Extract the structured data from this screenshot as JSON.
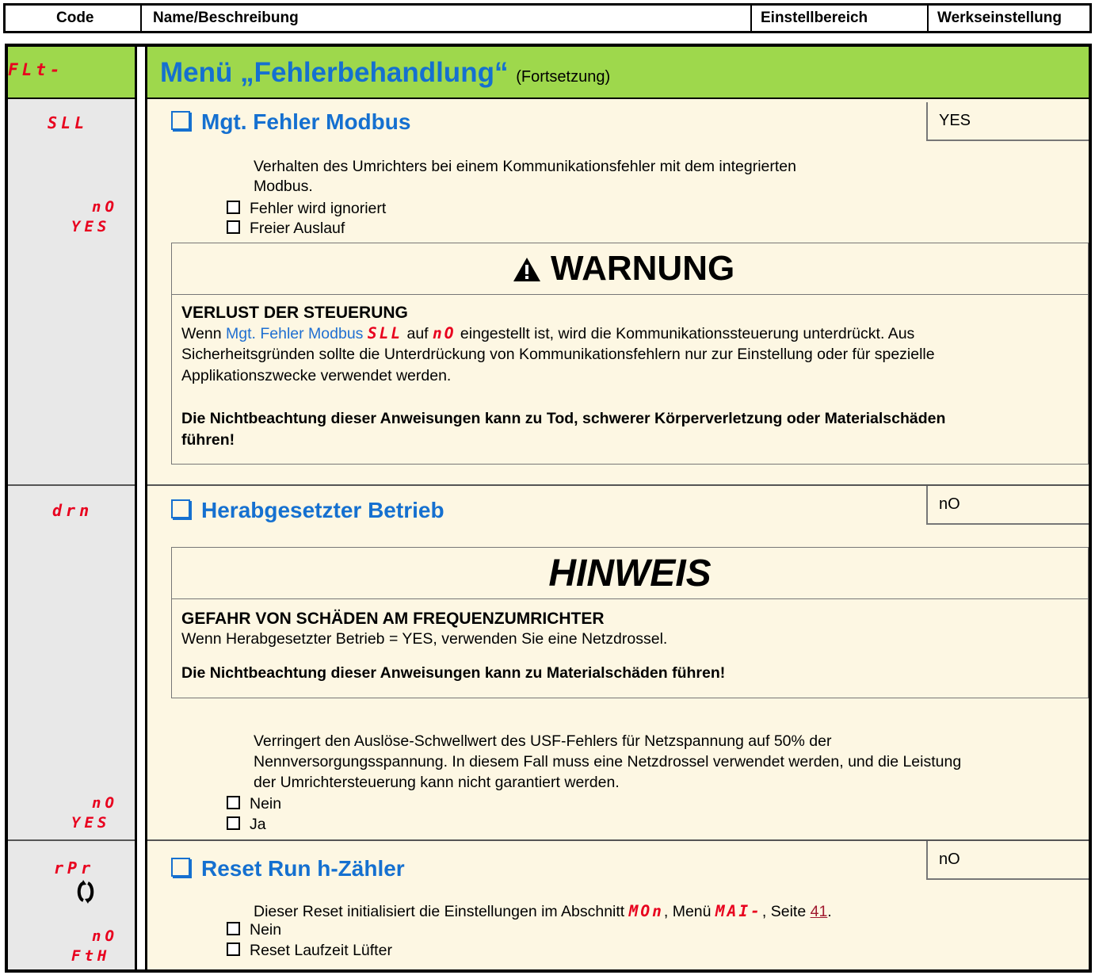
{
  "header": {
    "col_code": "Code",
    "col_name": "Name/Beschreibung",
    "col_range": "Einstellbereich",
    "col_factory": "Werkseinstellung"
  },
  "menu": {
    "code": "FLt-",
    "title": "Menü „Fehlerbehandlung“",
    "suffix": "(Fortsetzung)"
  },
  "sll": {
    "code": "SLL",
    "name": "Mgt. Fehler Modbus",
    "factory": "YES",
    "desc_line1": "Verhalten des Umrichters bei einem Kommunikationsfehler mit dem integrierten",
    "desc_line2": "Modbus.",
    "options": [
      {
        "code": "nO",
        "label": "Fehler wird ignoriert"
      },
      {
        "code": "YES",
        "label": "Freier Auslauf"
      }
    ]
  },
  "warning": {
    "title": "WARNUNG",
    "subtitle": "VERLUST DER STEUERUNG",
    "l1_pre": "Wenn ",
    "l1_link": "Mgt. Fehler Modbus",
    "l1_code1": "SLL",
    "l1_mid": " auf ",
    "l1_code2": "nO",
    "l1_post": " eingestellt ist, wird die Kommunikationssteuerung unterdrückt. Aus",
    "l2": "Sicherheitsgründen sollte die Unterdrückung von Kommunikationsfehlern nur zur Einstellung oder für spezielle",
    "l3": "Applikationszwecke verwendet werden.",
    "bold1": "Die Nichtbeachtung dieser Anweisungen kann zu Tod, schwerer Körperverletzung oder Materialschäden",
    "bold2": "führen!"
  },
  "drn": {
    "code": "drn",
    "name": "Herabgesetzter Betrieb",
    "factory": "nO",
    "desc_line1": "Verringert den Auslöse-Schwellwert des USF-Fehlers für Netzspannung auf 50% der",
    "desc_line2": "Nennversorgungsspannung. In diesem Fall muss eine Netzdrossel verwendet werden, und die Leistung",
    "desc_line3": "der Umrichtersteuerung kann nicht garantiert werden.",
    "options": [
      {
        "code": "nO",
        "label": "Nein"
      },
      {
        "code": "YES",
        "label": "Ja"
      }
    ]
  },
  "notice": {
    "title": "HINWEIS",
    "subtitle": "GEFAHR VON SCHÄDEN AM FREQUENZUMRICHTER",
    "l1": "Wenn Herabgesetzter Betrieb = YES, verwenden Sie eine Netzdrossel.",
    "bold": "Die Nichtbeachtung dieser Anweisungen kann zu Materialschäden führen!"
  },
  "rpr": {
    "code": "rPr",
    "name": "Reset Run h-Zähler",
    "factory": "nO",
    "desc_pre": "Dieser Reset initialisiert die Einstellungen im Abschnitt ",
    "desc_code1": "MOn",
    "desc_mid": ", Menü ",
    "desc_code2": "MAI-",
    "desc_mid2": ", Seite ",
    "desc_page": "41",
    "desc_post": ".",
    "options": [
      {
        "code": "nO",
        "label": "Nein"
      },
      {
        "code": "FtH",
        "label": "Reset Laufzeit Lüfter"
      }
    ]
  },
  "colors": {
    "menu_green": "#9ed84c",
    "param_blue": "#1570d0",
    "code_red": "#e8001e",
    "cream": "#fdf7e3"
  }
}
